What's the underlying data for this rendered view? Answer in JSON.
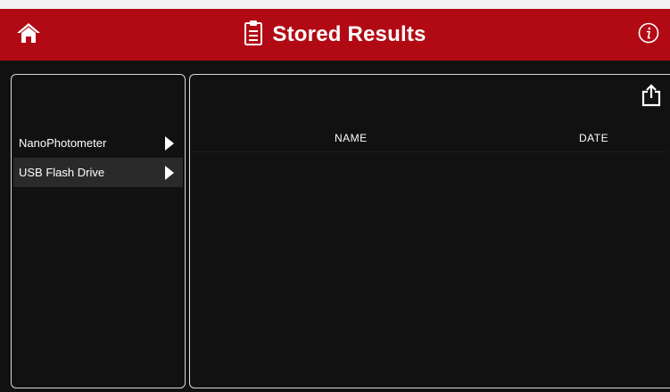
{
  "app": {
    "title": "Stored Results",
    "title_icon": "clipboard-icon",
    "accent_color": "#b20a14"
  },
  "header": {
    "home_icon": "home-icon",
    "info_icon": "info-icon"
  },
  "sources": {
    "items": [
      {
        "label": "NanoPhotometer",
        "icon": "chevron-right-icon",
        "selected": false
      },
      {
        "label": "USB Flash Drive",
        "icon": "chevron-right-icon",
        "selected": true
      }
    ]
  },
  "results": {
    "export_icon": "share-icon",
    "columns": [
      "NAME",
      "DATE"
    ],
    "rows": []
  }
}
